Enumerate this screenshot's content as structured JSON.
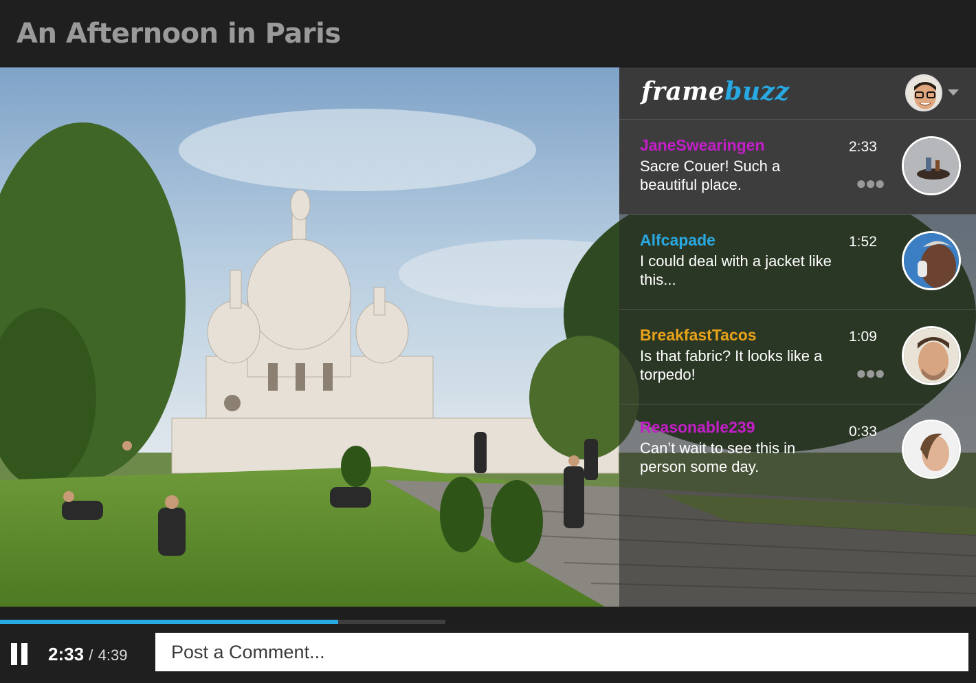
{
  "video": {
    "title": "An Afternoon in Paris"
  },
  "app": {
    "logo_part1": "frame",
    "logo_part2": "buzz",
    "accent": "#29a9e1"
  },
  "comments": [
    {
      "user": "JaneSwearingen",
      "user_color": "#c41ec9",
      "text": "Sacre Couer! Such a beautiful place.",
      "time": "2:33",
      "has_more": true
    },
    {
      "user": "Alfcapade",
      "user_color": "#29a9e1",
      "text": "I could deal with a jacket like this...",
      "time": "1:52",
      "has_more": false
    },
    {
      "user": "BreakfastTacos",
      "user_color": "#e8a21a",
      "text": "Is that fabric? It looks like a torpedo!",
      "time": "1:09",
      "has_more": true
    },
    {
      "user": "Reasonable239",
      "user_color": "#c41ec9",
      "text": "Can’t wait to see this in person some day.",
      "time": "0:33",
      "has_more": false
    }
  ],
  "player": {
    "current_time": "2:33",
    "separator": "/",
    "duration": "4:39",
    "progress": 0.759,
    "comment_placeholder": "Post a Comment..."
  },
  "icons": {
    "more": "more-dots-icon",
    "pause": "pause-icon",
    "dropdown": "chevron-down-icon"
  }
}
